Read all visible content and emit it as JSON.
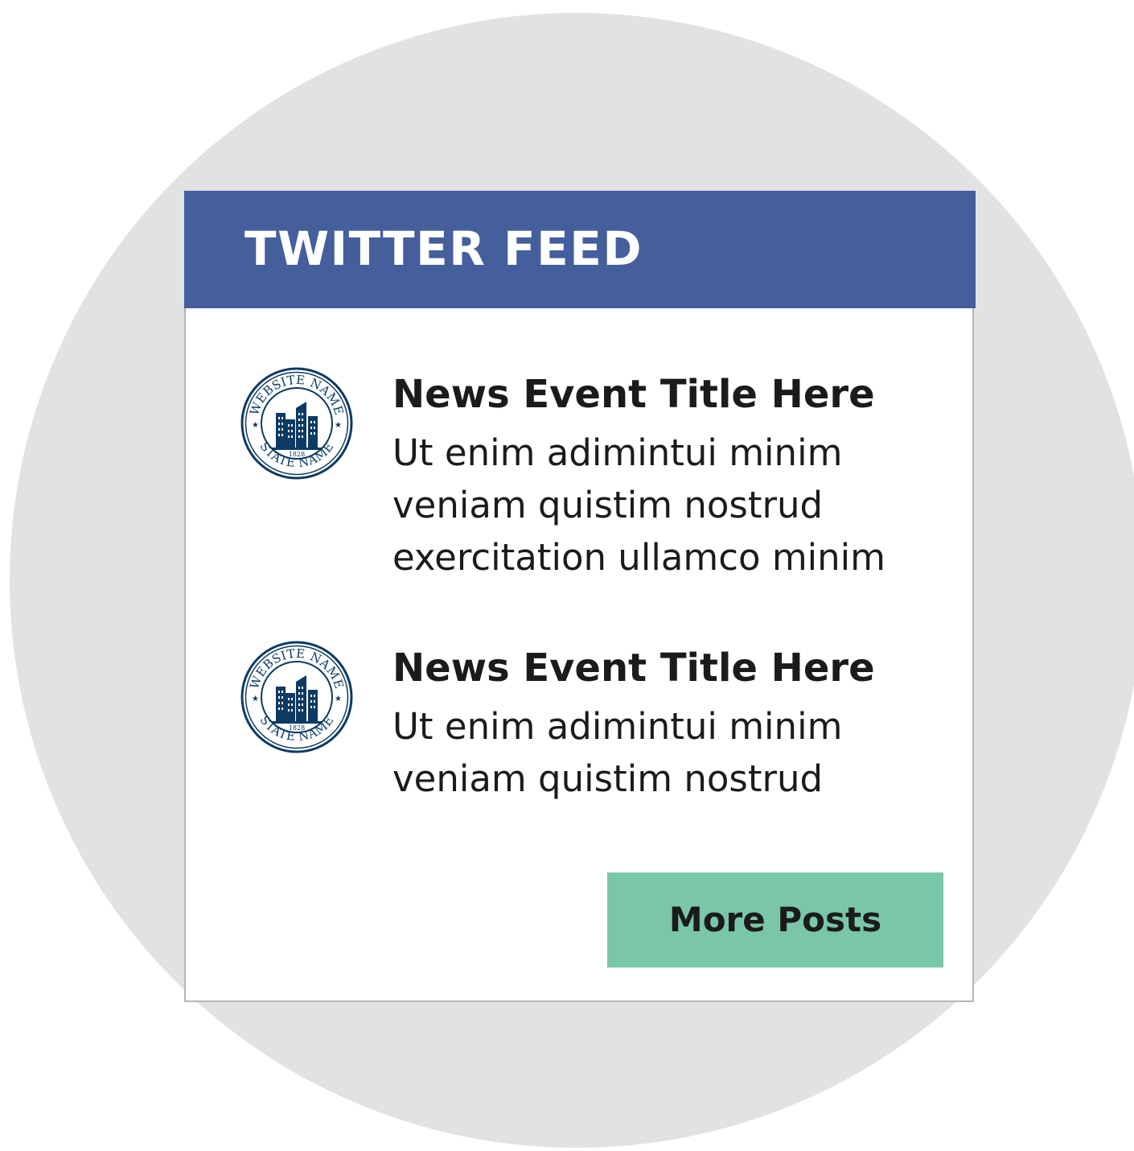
{
  "widget": {
    "title": "TWITTER FEED"
  },
  "posts": [
    {
      "title": "News Event Title Here",
      "body_lines": [
        "Ut enim adimintui minim",
        "veniam quistim nostrud",
        "exercitation ullamco minim"
      ],
      "seal": {
        "top_text": "WEBSITE NAME",
        "bottom_text": "STATE NAME",
        "year": "1828"
      }
    },
    {
      "title": "News Event Title Here",
      "body_lines": [
        "Ut enim adimintui minim",
        "veniam quistim nostrud"
      ],
      "seal": {
        "top_text": "WEBSITE NAME",
        "bottom_text": "STATE NAME",
        "year": "1828"
      }
    }
  ],
  "more_button": {
    "label": "More Posts"
  },
  "colors": {
    "header": "#455f9c",
    "button": "#79c7a8",
    "background_circle": "#e1e2e4",
    "seal": "#0d3a63"
  },
  "icons": {
    "avatar": "building-seal-icon"
  }
}
